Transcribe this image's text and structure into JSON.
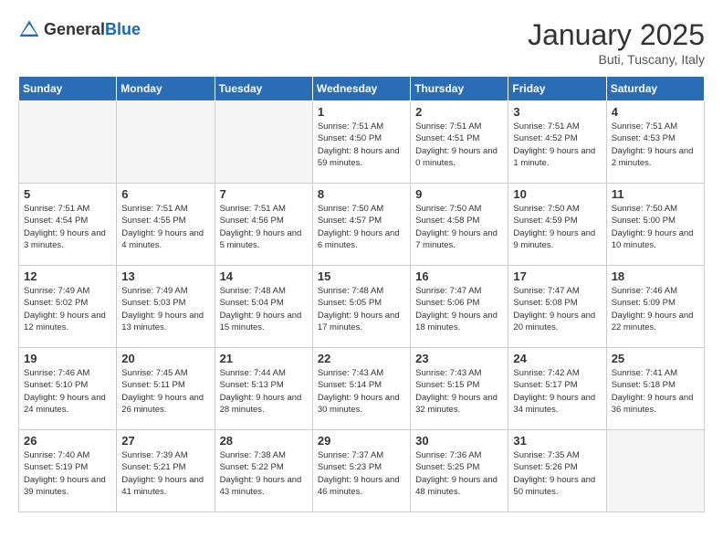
{
  "header": {
    "logo_general": "General",
    "logo_blue": "Blue",
    "title": "January 2025",
    "subtitle": "Buti, Tuscany, Italy"
  },
  "weekdays": [
    "Sunday",
    "Monday",
    "Tuesday",
    "Wednesday",
    "Thursday",
    "Friday",
    "Saturday"
  ],
  "weeks": [
    [
      {
        "day": "",
        "info": ""
      },
      {
        "day": "",
        "info": ""
      },
      {
        "day": "",
        "info": ""
      },
      {
        "day": "1",
        "info": "Sunrise: 7:51 AM\nSunset: 4:50 PM\nDaylight: 8 hours\nand 59 minutes."
      },
      {
        "day": "2",
        "info": "Sunrise: 7:51 AM\nSunset: 4:51 PM\nDaylight: 9 hours\nand 0 minutes."
      },
      {
        "day": "3",
        "info": "Sunrise: 7:51 AM\nSunset: 4:52 PM\nDaylight: 9 hours\nand 1 minute."
      },
      {
        "day": "4",
        "info": "Sunrise: 7:51 AM\nSunset: 4:53 PM\nDaylight: 9 hours\nand 2 minutes."
      }
    ],
    [
      {
        "day": "5",
        "info": "Sunrise: 7:51 AM\nSunset: 4:54 PM\nDaylight: 9 hours\nand 3 minutes."
      },
      {
        "day": "6",
        "info": "Sunrise: 7:51 AM\nSunset: 4:55 PM\nDaylight: 9 hours\nand 4 minutes."
      },
      {
        "day": "7",
        "info": "Sunrise: 7:51 AM\nSunset: 4:56 PM\nDaylight: 9 hours\nand 5 minutes."
      },
      {
        "day": "8",
        "info": "Sunrise: 7:50 AM\nSunset: 4:57 PM\nDaylight: 9 hours\nand 6 minutes."
      },
      {
        "day": "9",
        "info": "Sunrise: 7:50 AM\nSunset: 4:58 PM\nDaylight: 9 hours\nand 7 minutes."
      },
      {
        "day": "10",
        "info": "Sunrise: 7:50 AM\nSunset: 4:59 PM\nDaylight: 9 hours\nand 9 minutes."
      },
      {
        "day": "11",
        "info": "Sunrise: 7:50 AM\nSunset: 5:00 PM\nDaylight: 9 hours\nand 10 minutes."
      }
    ],
    [
      {
        "day": "12",
        "info": "Sunrise: 7:49 AM\nSunset: 5:02 PM\nDaylight: 9 hours\nand 12 minutes."
      },
      {
        "day": "13",
        "info": "Sunrise: 7:49 AM\nSunset: 5:03 PM\nDaylight: 9 hours\nand 13 minutes."
      },
      {
        "day": "14",
        "info": "Sunrise: 7:48 AM\nSunset: 5:04 PM\nDaylight: 9 hours\nand 15 minutes."
      },
      {
        "day": "15",
        "info": "Sunrise: 7:48 AM\nSunset: 5:05 PM\nDaylight: 9 hours\nand 17 minutes."
      },
      {
        "day": "16",
        "info": "Sunrise: 7:47 AM\nSunset: 5:06 PM\nDaylight: 9 hours\nand 18 minutes."
      },
      {
        "day": "17",
        "info": "Sunrise: 7:47 AM\nSunset: 5:08 PM\nDaylight: 9 hours\nand 20 minutes."
      },
      {
        "day": "18",
        "info": "Sunrise: 7:46 AM\nSunset: 5:09 PM\nDaylight: 9 hours\nand 22 minutes."
      }
    ],
    [
      {
        "day": "19",
        "info": "Sunrise: 7:46 AM\nSunset: 5:10 PM\nDaylight: 9 hours\nand 24 minutes."
      },
      {
        "day": "20",
        "info": "Sunrise: 7:45 AM\nSunset: 5:11 PM\nDaylight: 9 hours\nand 26 minutes."
      },
      {
        "day": "21",
        "info": "Sunrise: 7:44 AM\nSunset: 5:13 PM\nDaylight: 9 hours\nand 28 minutes."
      },
      {
        "day": "22",
        "info": "Sunrise: 7:43 AM\nSunset: 5:14 PM\nDaylight: 9 hours\nand 30 minutes."
      },
      {
        "day": "23",
        "info": "Sunrise: 7:43 AM\nSunset: 5:15 PM\nDaylight: 9 hours\nand 32 minutes."
      },
      {
        "day": "24",
        "info": "Sunrise: 7:42 AM\nSunset: 5:17 PM\nDaylight: 9 hours\nand 34 minutes."
      },
      {
        "day": "25",
        "info": "Sunrise: 7:41 AM\nSunset: 5:18 PM\nDaylight: 9 hours\nand 36 minutes."
      }
    ],
    [
      {
        "day": "26",
        "info": "Sunrise: 7:40 AM\nSunset: 5:19 PM\nDaylight: 9 hours\nand 39 minutes."
      },
      {
        "day": "27",
        "info": "Sunrise: 7:39 AM\nSunset: 5:21 PM\nDaylight: 9 hours\nand 41 minutes."
      },
      {
        "day": "28",
        "info": "Sunrise: 7:38 AM\nSunset: 5:22 PM\nDaylight: 9 hours\nand 43 minutes."
      },
      {
        "day": "29",
        "info": "Sunrise: 7:37 AM\nSunset: 5:23 PM\nDaylight: 9 hours\nand 46 minutes."
      },
      {
        "day": "30",
        "info": "Sunrise: 7:36 AM\nSunset: 5:25 PM\nDaylight: 9 hours\nand 48 minutes."
      },
      {
        "day": "31",
        "info": "Sunrise: 7:35 AM\nSunset: 5:26 PM\nDaylight: 9 hours\nand 50 minutes."
      },
      {
        "day": "",
        "info": ""
      }
    ]
  ]
}
